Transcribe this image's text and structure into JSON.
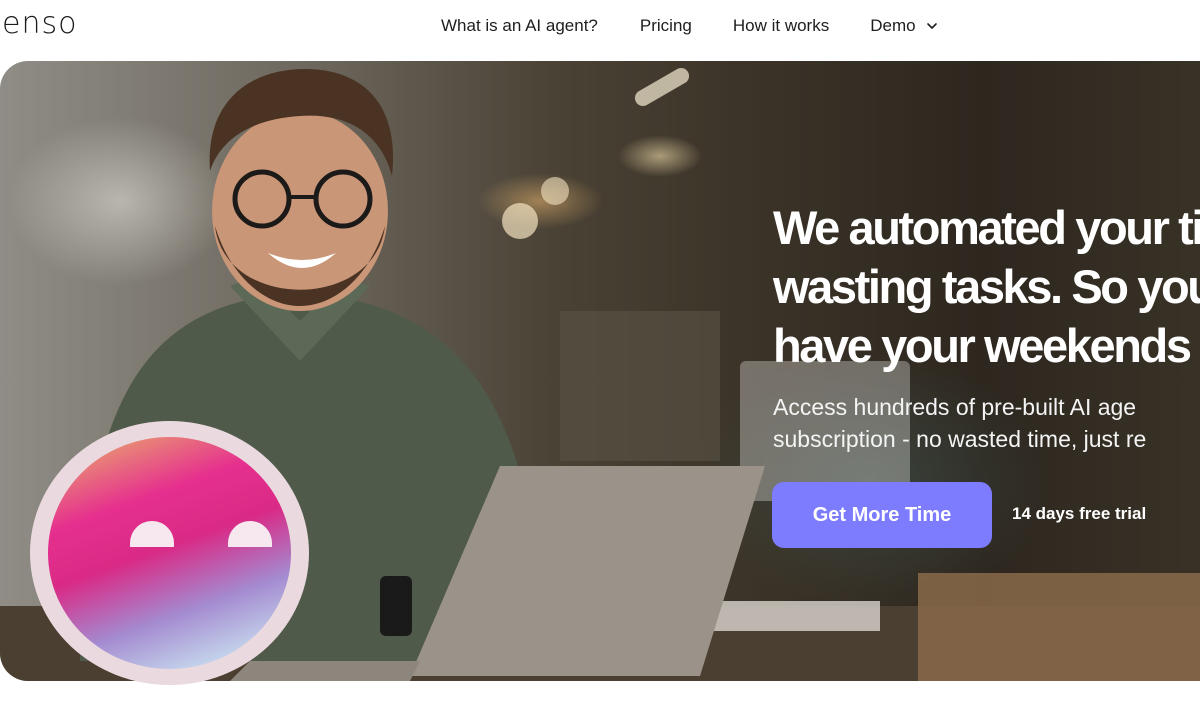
{
  "nav": {
    "logo": "enso",
    "links": [
      {
        "label": "What is an AI agent?"
      },
      {
        "label": "Pricing"
      },
      {
        "label": "How it works"
      },
      {
        "label": "Demo"
      }
    ]
  },
  "hero": {
    "headline_lines": [
      "We automated your ti",
      "wasting tasks. So you",
      "have your weekends"
    ],
    "subtext_lines": [
      "Access hundreds of pre-built AI age",
      "subscription - no wasted time, just re"
    ],
    "cta_label": "Get More Time",
    "trial_text": "14 days free trial"
  },
  "icons": {
    "demo_chevron": "chevron-down-icon",
    "mascot": "smiley-mascot-icon"
  },
  "colors": {
    "accent": "#7d7cff",
    "text_dark": "#1e1e1e",
    "hero_text": "#ffffff"
  }
}
